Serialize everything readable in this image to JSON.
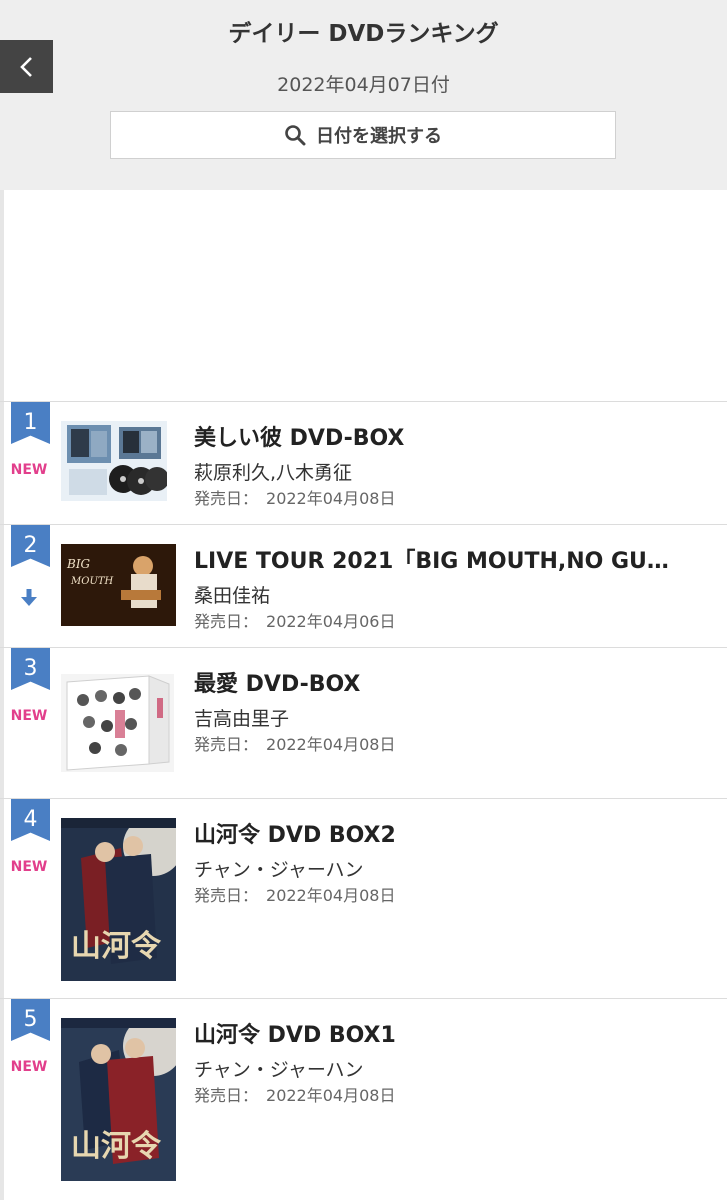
{
  "header": {
    "title": "デイリー DVDランキング",
    "date": "2022年04月07日付",
    "date_button_label": "日付を選択する"
  },
  "release_label": "発売日：",
  "rankings": [
    {
      "rank": "1",
      "status": "NEW",
      "title": "美しい彼 DVD-BOX",
      "artist": "萩原利久,八木勇征",
      "release_date": "2022年04月08日"
    },
    {
      "rank": "2",
      "status": "down",
      "title": "LIVE TOUR 2021「BIG MOUTH,NO GU…",
      "artist": "桑田佳祐",
      "release_date": "2022年04月06日"
    },
    {
      "rank": "3",
      "status": "NEW",
      "title": "最愛 DVD-BOX",
      "artist": "吉高由里子",
      "release_date": "2022年04月08日"
    },
    {
      "rank": "4",
      "status": "NEW",
      "title": "山河令 DVD BOX2",
      "artist": "チャン・ジャーハン",
      "release_date": "2022年04月08日"
    },
    {
      "rank": "5",
      "status": "NEW",
      "title": "山河令 DVD BOX1",
      "artist": "チャン・ジャーハン",
      "release_date": "2022年04月08日"
    }
  ],
  "colors": {
    "rank_flag": "#4a7fc4",
    "new_label": "#e23f8c",
    "header_bg": "#eeeeee",
    "back_button": "#444444"
  },
  "icons": {
    "back": "chevron-left-icon",
    "search": "search-icon",
    "rank_down": "arrow-down-icon"
  }
}
